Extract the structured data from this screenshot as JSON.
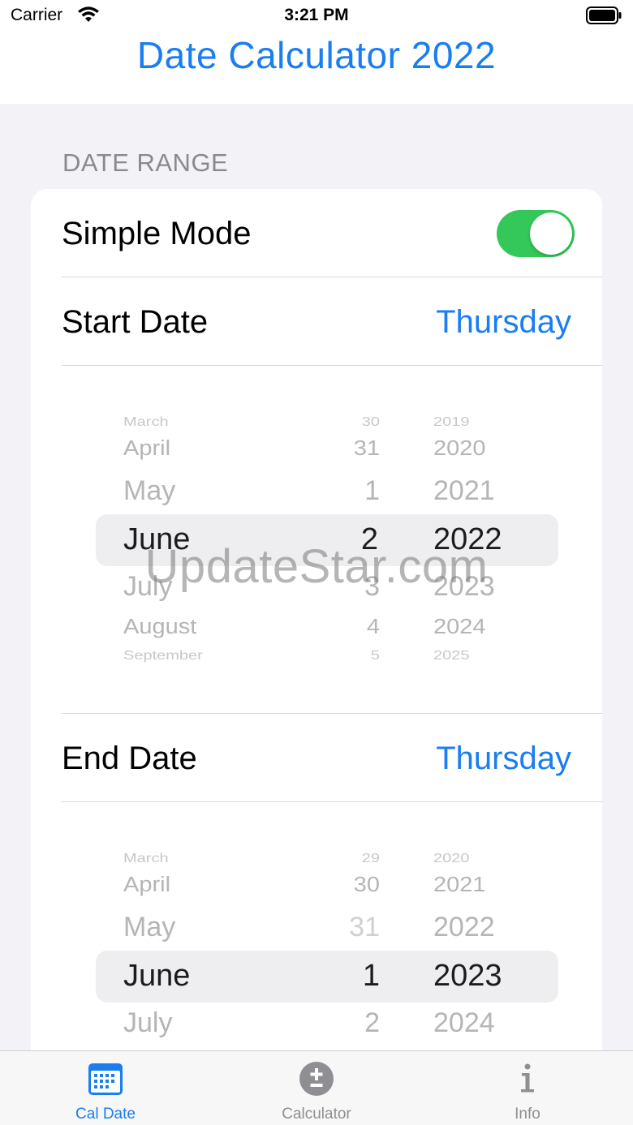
{
  "status": {
    "carrier": "Carrier",
    "time": "3:21 PM"
  },
  "header": {
    "title": "Date Calculator 2022"
  },
  "section": {
    "header": "DATE RANGE"
  },
  "simple_mode": {
    "label": "Simple Mode",
    "on": true
  },
  "start": {
    "label": "Start Date",
    "weekday": "Thursday",
    "picker": {
      "months": [
        "March",
        "April",
        "May",
        "June",
        "July",
        "August",
        "September"
      ],
      "days": [
        "30",
        "31",
        "1",
        "2",
        "3",
        "4",
        "5"
      ],
      "years": [
        "2019",
        "2020",
        "2021",
        "2022",
        "2023",
        "2024",
        "2025"
      ],
      "selected": {
        "month": "June",
        "day": "2",
        "year": "2022"
      }
    }
  },
  "end": {
    "label": "End Date",
    "weekday": "Thursday",
    "picker": {
      "months": [
        "March",
        "April",
        "May",
        "June",
        "July"
      ],
      "days": [
        "29",
        "30",
        "31",
        "1",
        "2"
      ],
      "years": [
        "2020",
        "2021",
        "2022",
        "2023",
        "2024"
      ],
      "selected": {
        "month": "June",
        "day": "1",
        "year": "2023"
      }
    }
  },
  "watermark": "UpdateStar.com",
  "tabs": [
    {
      "label": "Cal Date",
      "icon": "calendar-icon",
      "active": true
    },
    {
      "label": "Calculator",
      "icon": "plus-minus-icon",
      "active": false
    },
    {
      "label": "Info",
      "icon": "info-icon",
      "active": false
    }
  ],
  "colors": {
    "accent": "#1a7df0",
    "toggle_on": "#34c759",
    "background": "#f2f2f7"
  }
}
